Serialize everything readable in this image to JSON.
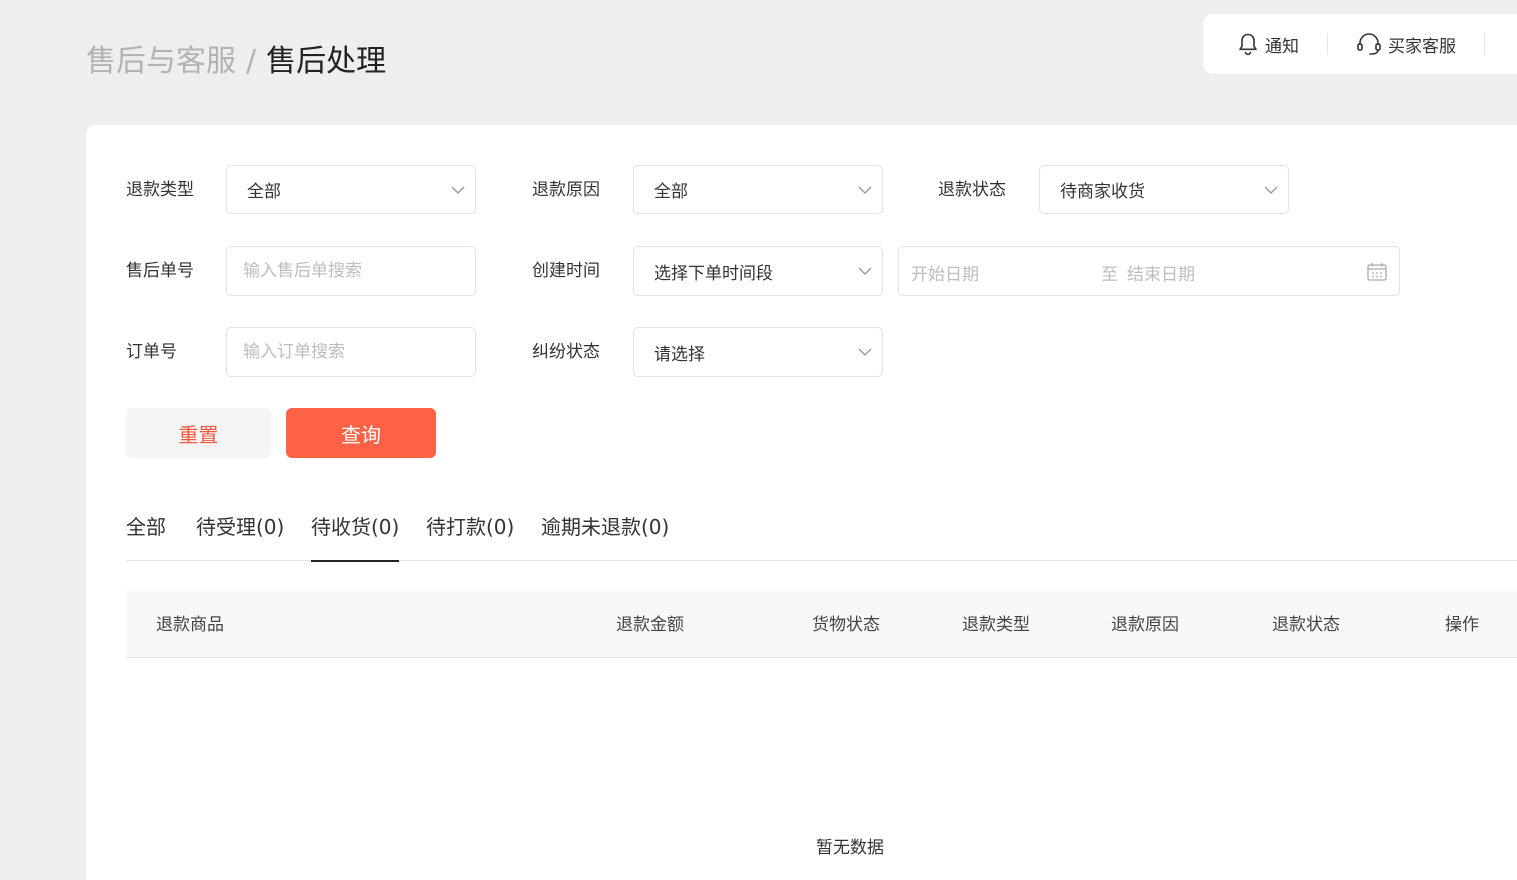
{
  "breadcrumb": {
    "parent": "售后与客服",
    "separator": "/",
    "current": "售后处理"
  },
  "topbar": {
    "notify_label": "通知",
    "service_label": "买家客服"
  },
  "filters": {
    "refund_type": {
      "label": "退款类型",
      "value": "全部"
    },
    "refund_reason": {
      "label": "退款原因",
      "value": "全部"
    },
    "refund_status": {
      "label": "退款状态",
      "value": "待商家收货"
    },
    "aftersale_no": {
      "label": "售后单号",
      "placeholder": "输入售后单搜索"
    },
    "create_time": {
      "label": "创建时间",
      "value": "选择下单时间段"
    },
    "date_range": {
      "start_placeholder": "开始日期",
      "separator": "至",
      "end_placeholder": "结束日期"
    },
    "order_no": {
      "label": "订单号",
      "placeholder": "输入订单搜索"
    },
    "dispute_status": {
      "label": "纠纷状态",
      "value": "请选择"
    }
  },
  "buttons": {
    "reset": "重置",
    "query": "查询"
  },
  "tabs": [
    {
      "label": "全部"
    },
    {
      "label": "待受理(0)"
    },
    {
      "label": "待收货(0)"
    },
    {
      "label": "待打款(0)"
    },
    {
      "label": "逾期未退款(0)"
    }
  ],
  "active_tab": "待收货(0)",
  "table": {
    "columns": [
      "退款商品",
      "退款金额",
      "货物状态",
      "退款类型",
      "退款原因",
      "退款状态",
      "操作"
    ],
    "empty_text": "暂无数据"
  },
  "colors": {
    "accent": "#fd6246",
    "reset_text": "#f15a3f"
  }
}
